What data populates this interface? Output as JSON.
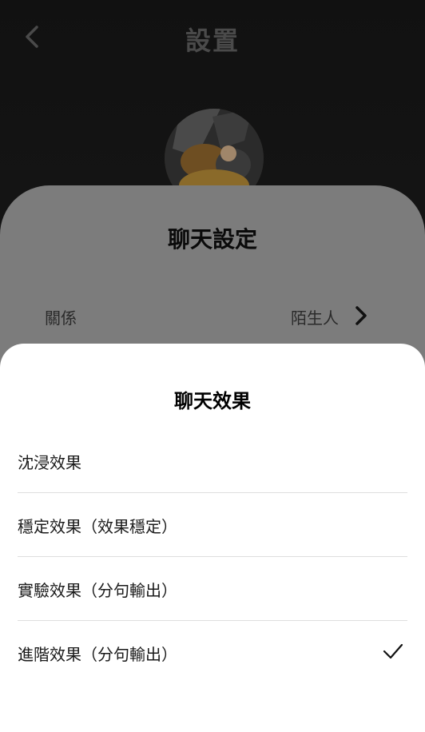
{
  "header": {
    "title": "設置",
    "back_icon": "chevron-left-icon"
  },
  "chat_settings": {
    "title": "聊天設定",
    "relation": {
      "label": "關係",
      "value": "陌生人",
      "icon": "chevron-right-icon"
    }
  },
  "chat_effect_sheet": {
    "title": "聊天效果",
    "options": [
      {
        "label": "沈浸效果",
        "selected": false
      },
      {
        "label": "穩定效果（效果穩定）",
        "selected": false
      },
      {
        "label": "實驗效果（分句輸出）",
        "selected": false
      },
      {
        "label": "進階效果（分句輸出）",
        "selected": true
      }
    ],
    "selected_icon": "check-icon"
  }
}
